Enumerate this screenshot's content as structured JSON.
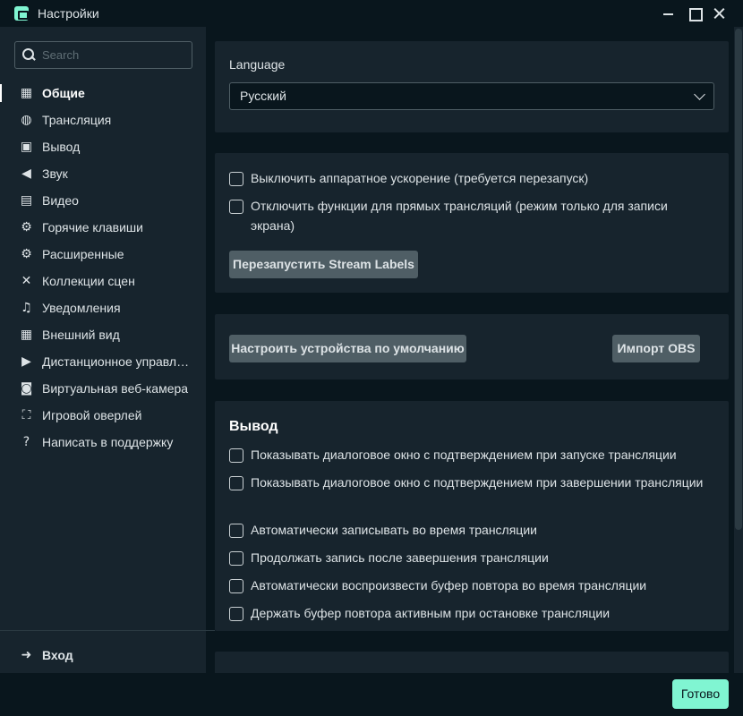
{
  "window": {
    "title": "Настройки"
  },
  "search": {
    "placeholder": "Search"
  },
  "sidebar": {
    "items": [
      {
        "label": "Общие",
        "icon": "grid-icon",
        "active": true
      },
      {
        "label": "Трансляция",
        "icon": "globe-icon"
      },
      {
        "label": "Вывод",
        "icon": "chip-icon"
      },
      {
        "label": "Звук",
        "icon": "speaker-icon"
      },
      {
        "label": "Видео",
        "icon": "film-icon"
      },
      {
        "label": "Горячие клавиши",
        "icon": "gear-icon"
      },
      {
        "label": "Расширенные",
        "icon": "gears-icon"
      },
      {
        "label": "Коллекции сцен",
        "icon": "tools-icon"
      },
      {
        "label": "Уведомления",
        "icon": "bell-icon"
      },
      {
        "label": "Внешний вид",
        "icon": "layout-icon"
      },
      {
        "label": "Дистанционное управление",
        "icon": "play-circle-icon"
      },
      {
        "label": "Виртуальная веб-камера",
        "icon": "camera-icon"
      },
      {
        "label": "Игровой оверлей",
        "icon": "expand-icon"
      },
      {
        "label": "Написать в поддержку",
        "icon": "help-icon"
      }
    ],
    "login_label": "Вход"
  },
  "language": {
    "label": "Language",
    "selected": "Русский"
  },
  "hardware": {
    "options": [
      {
        "label": "Выключить аппаратное ускорение (требуется перезапуск)",
        "checked": false
      },
      {
        "label": "Отключить функции для прямых трансляций (режим только для записи экрана)",
        "checked": false
      }
    ],
    "restart_button": "Перезапустить Stream Labels"
  },
  "devices": {
    "configure_button": "Настроить устройства по умолчанию",
    "import_button": "Импорт OBS"
  },
  "output": {
    "title": "Вывод",
    "options": [
      {
        "label": "Показывать диалоговое окно с подтверждением при запуске трансляции",
        "checked": false
      },
      {
        "label": "Показывать диалоговое окно с подтверждением при завершении трансляции",
        "checked": false
      },
      {
        "label": "Автоматически записывать во время трансляции",
        "checked": false
      },
      {
        "label": "Продолжать запись после завершения трансляции",
        "checked": false
      },
      {
        "label": "Автоматически воспроизвести буфер повтора во время трансляции",
        "checked": false
      },
      {
        "label": "Держать буфер повтора активным при остановке трансляции",
        "checked": false
      }
    ]
  },
  "footer": {
    "done_button": "Готово"
  },
  "colors": {
    "background": "#09161d",
    "panel": "#17242d",
    "accent": "#80f5d2",
    "button": "#4f5e65"
  }
}
